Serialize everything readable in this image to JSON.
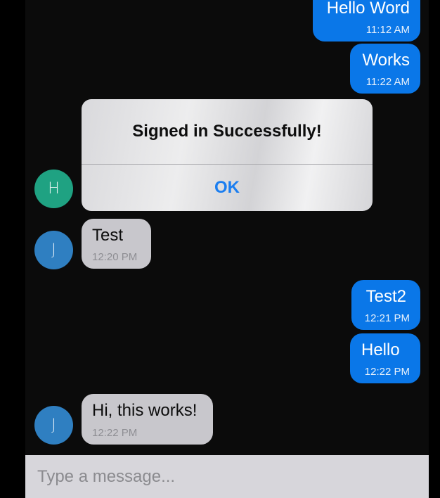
{
  "messages": [
    {
      "text": "Hello Word",
      "time": "11:12 AM",
      "direction": "outgoing"
    },
    {
      "text": "Works",
      "time": "11:22 AM",
      "direction": "outgoing"
    },
    {
      "text": "",
      "time": "",
      "direction": "incoming",
      "avatar": "H"
    },
    {
      "text": "Test",
      "time": "12:20 PM",
      "direction": "incoming",
      "avatar": "J"
    },
    {
      "text": "Test2",
      "time": "12:21 PM",
      "direction": "outgoing"
    },
    {
      "text": "Hello",
      "time": "12:22 PM",
      "direction": "outgoing"
    },
    {
      "text": "Hi, this works!",
      "time": "12:22 PM",
      "direction": "incoming",
      "avatar": "J"
    }
  ],
  "avatars": {
    "h": {
      "initial": "H",
      "color": "#1fa282"
    },
    "j": {
      "initial": "J",
      "color": "#2f7fc1"
    }
  },
  "alert": {
    "title": "Signed in Successfully!",
    "ok_label": "OK"
  },
  "composer": {
    "placeholder": "Type a message...",
    "value": ""
  },
  "colors": {
    "outgoing_bubble": "#0a77e8",
    "incoming_bubble": "#c8c7cc",
    "alert_action": "#1b7ef0"
  }
}
